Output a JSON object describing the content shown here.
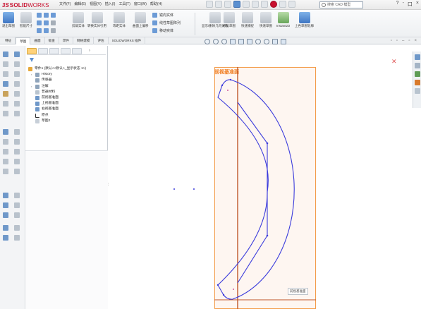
{
  "app": {
    "brand_ds": "3S",
    "brand_solid": "SOLID",
    "brand_works": "WORKS"
  },
  "menu": [
    "文件(F)",
    "编辑(E)",
    "视图(V)",
    "插入(I)",
    "工具(T)",
    "窗口(W)",
    "帮助(H)"
  ],
  "search": {
    "placeholder": "搜索 CAD 模型"
  },
  "window_controls": [
    "?",
    "-",
    "口",
    "×"
  ],
  "ribbon": {
    "buttons": [
      {
        "label": "退出草图",
        "icon": "exit-sketch-icon"
      },
      {
        "label": "智能尺寸",
        "icon": "smart-dimension-icon"
      },
      {
        "label": "剪裁实体",
        "icon": "trim-icon"
      },
      {
        "label": "转换实体引用",
        "icon": "convert-entities-icon"
      },
      {
        "label": "等距实体",
        "icon": "offset-entities-icon"
      },
      {
        "label": "曲面上偏移",
        "icon": "offset-on-surface-icon"
      }
    ],
    "small_items": [
      "镜向实体",
      "线性草图阵列",
      "移动实体"
    ],
    "right_buttons": [
      {
        "label": "显示/删除几何关系",
        "icon": "relations-icon"
      },
      {
        "label": "修复草图",
        "icon": "repair-sketch-icon"
      },
      {
        "label": "快速捕捉",
        "icon": "quick-snaps-icon"
      },
      {
        "label": "快速草图",
        "icon": "rapid-sketch-icon"
      },
      {
        "label": "Instant2D",
        "icon": "instant2d-icon"
      },
      {
        "label": "上色草图轮廓",
        "icon": "shaded-contours-icon"
      }
    ]
  },
  "tabs": [
    {
      "label": "特征",
      "active": false
    },
    {
      "label": "草图",
      "active": true
    },
    {
      "label": "曲面",
      "active": false
    },
    {
      "label": "钣金",
      "active": false
    },
    {
      "label": "焊件",
      "active": false
    },
    {
      "label": "网格建模",
      "active": false
    },
    {
      "label": "评估",
      "active": false
    },
    {
      "label": "SOLIDWORKS 插件",
      "active": false
    }
  ],
  "tree": {
    "root": "零件1 (默认<<默认>_显示状态 1>)",
    "items": [
      {
        "label": "History",
        "icon": "history-icon",
        "indent": 1,
        "caret": true
      },
      {
        "label": "传感器",
        "icon": "sensors-icon",
        "indent": 1,
        "caret": false
      },
      {
        "label": "注解",
        "icon": "annotations-icon",
        "indent": 1,
        "caret": true
      },
      {
        "label": "普通材料",
        "icon": "material-icon",
        "indent": 1,
        "caret": false
      },
      {
        "label": "前视基准面",
        "icon": "plane-icon",
        "indent": 1,
        "caret": false
      },
      {
        "label": "上视基准面",
        "icon": "plane-icon",
        "indent": 1,
        "caret": false
      },
      {
        "label": "右视基准面",
        "icon": "plane-icon",
        "indent": 1,
        "caret": false
      },
      {
        "label": "原点",
        "icon": "origin-icon",
        "indent": 1,
        "caret": false
      },
      {
        "label": "草图2",
        "icon": "sketch-icon",
        "indent": 1,
        "caret": false
      }
    ]
  },
  "graphics": {
    "plane_label": "前视基准面",
    "plane_tag": "前视基准面",
    "colors": {
      "plane_border": "#f39c4a",
      "sketch_line": "#3b3bdc",
      "plane_fill": "#fef6f1"
    }
  }
}
